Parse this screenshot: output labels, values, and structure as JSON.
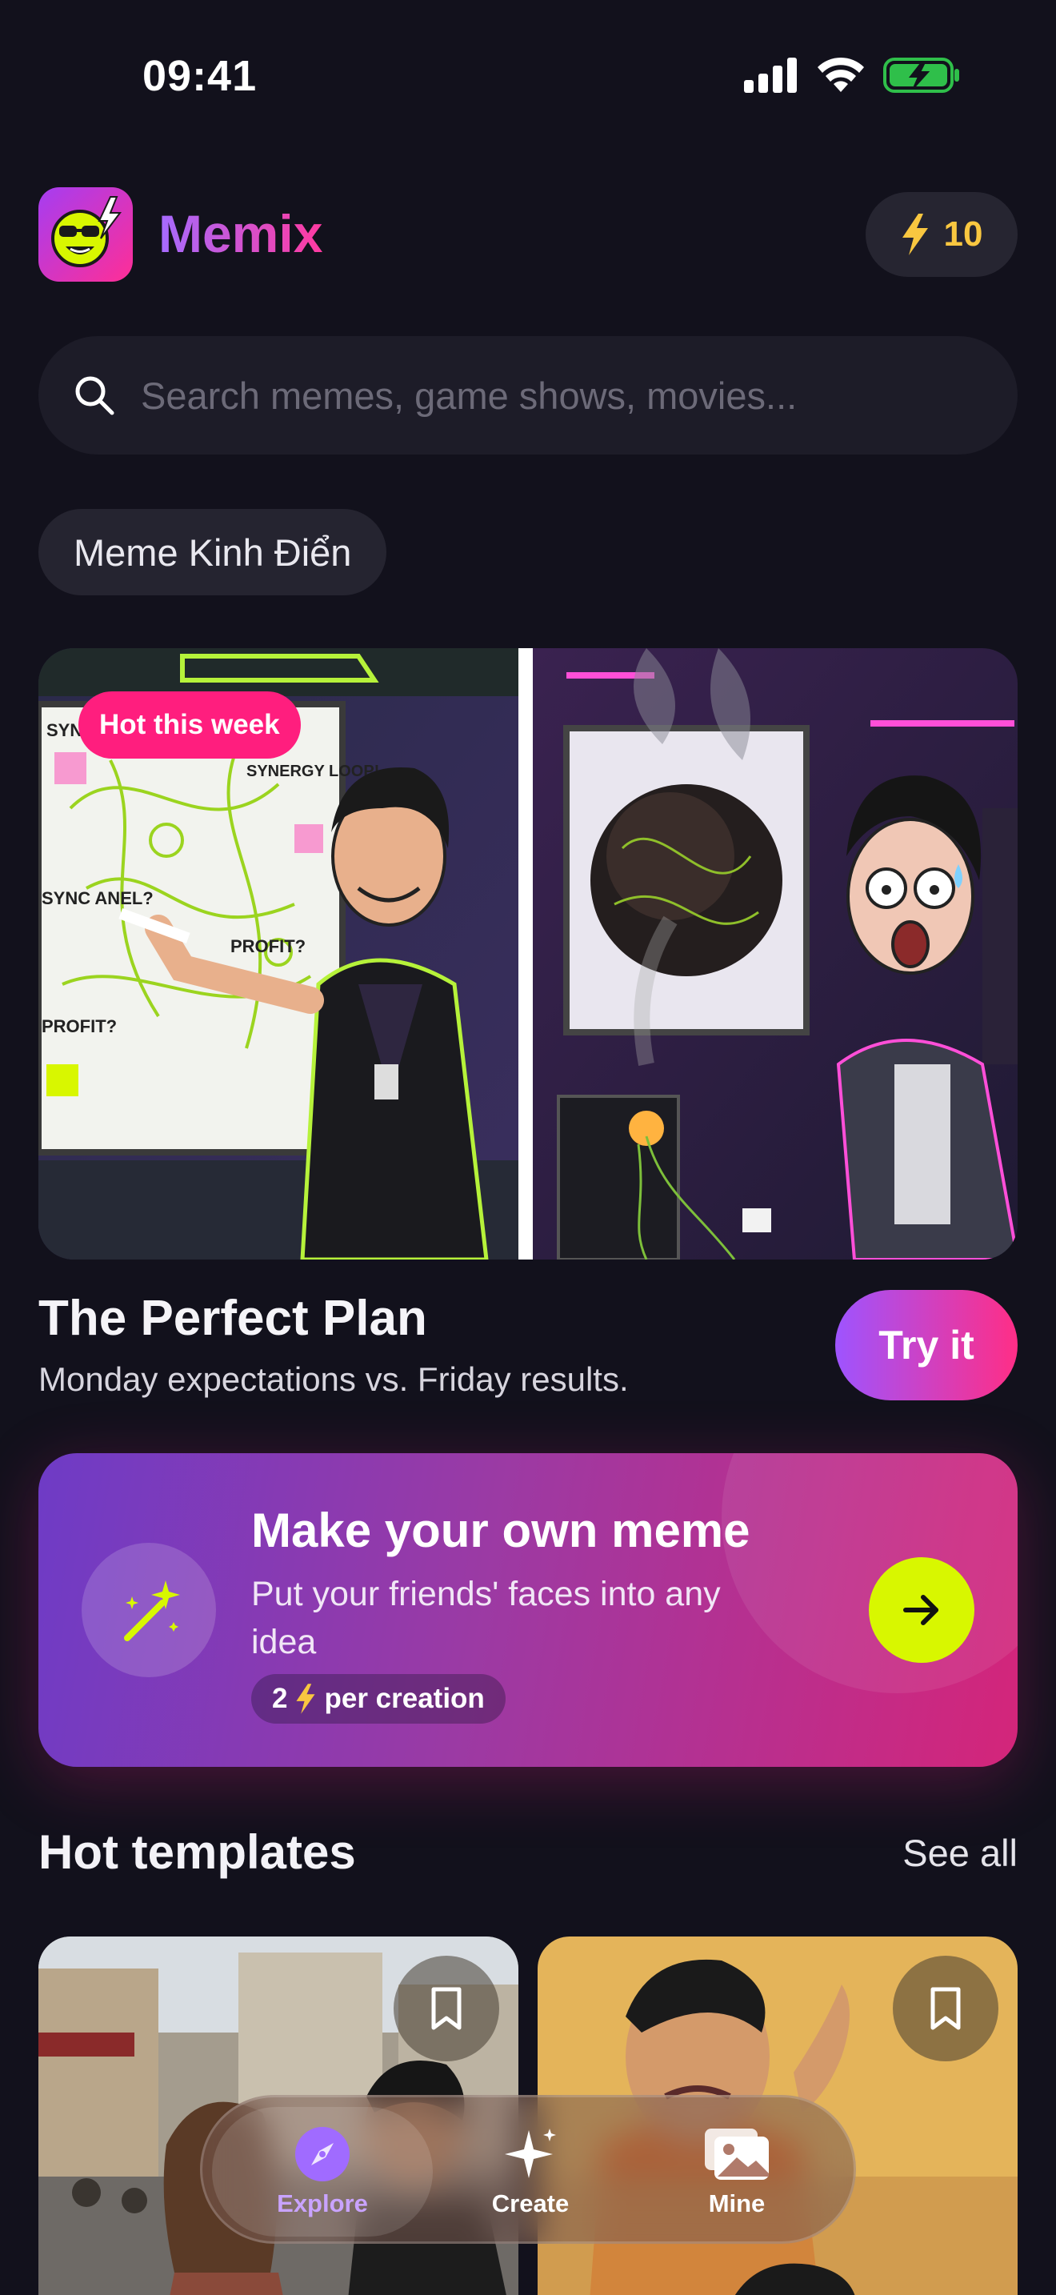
{
  "status_bar": {
    "time": "09:41"
  },
  "header": {
    "app_name": "Memix",
    "credits": "10"
  },
  "search": {
    "placeholder": "Search memes, game shows, movies..."
  },
  "categories": {
    "selected": "Meme Kinh Điển"
  },
  "hero": {
    "badge": "Hot this week",
    "title": "The Perfect Plan",
    "subtitle": "Monday expectations vs. Friday results.",
    "cta": "Try it",
    "whiteboard_texts": [
      "SYNC PROTO",
      "SYNERGY LOOP!",
      "SYNC ANEL?",
      "PROFIT?",
      "PROFIT?"
    ]
  },
  "promo": {
    "title": "Make your own meme",
    "description": "Put your friends' faces into any idea",
    "cost_number": "2",
    "cost_suffix": "per creation"
  },
  "templates_section": {
    "title": "Hot templates",
    "see_all": "See all"
  },
  "tabs": [
    {
      "label": "Explore",
      "icon": "compass-icon",
      "active": true
    },
    {
      "label": "Create",
      "icon": "sparkle-icon",
      "active": false
    },
    {
      "label": "Mine",
      "icon": "photos-icon",
      "active": false
    }
  ],
  "colors": {
    "background": "#12111c",
    "accent_purple": "#a56bff",
    "accent_pink": "#ff2e86",
    "lime": "#d8f700",
    "credit_yellow": "#f9c740"
  }
}
